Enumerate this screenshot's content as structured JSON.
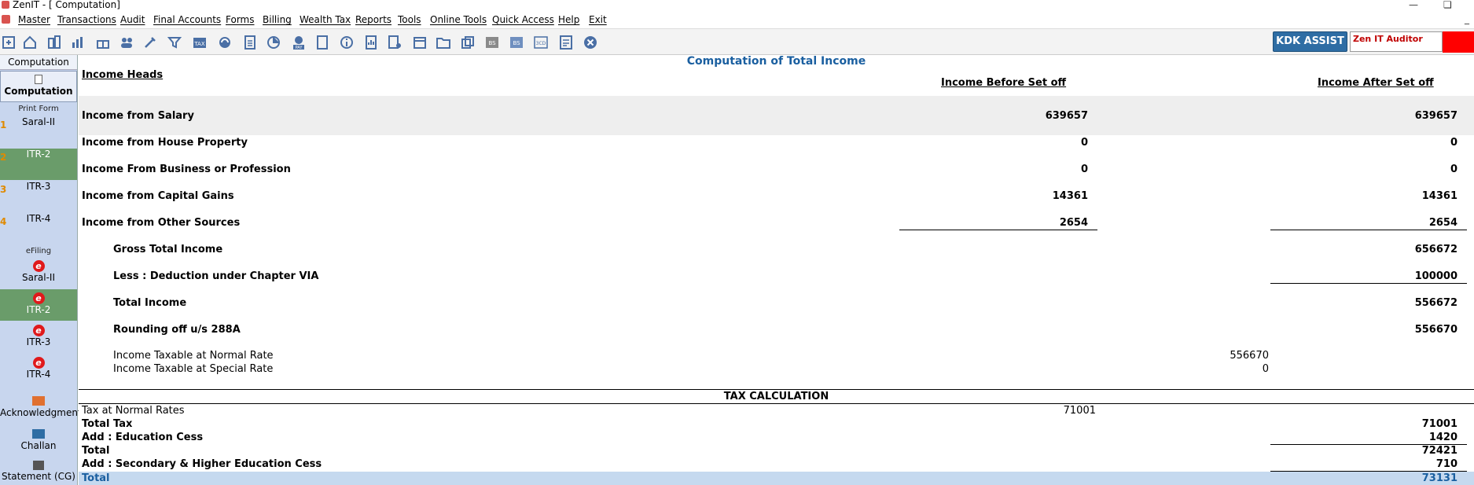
{
  "window": {
    "title": "ZenIT - [ Computation]"
  },
  "menu": [
    "Master",
    "Transactions",
    "Audit",
    "Final Accounts",
    "Forms",
    "Billing",
    "Wealth Tax",
    "Reports",
    "Tools",
    "Online Tools",
    "Quick Access",
    "Help",
    "Exit"
  ],
  "toolbar": {
    "icons": [
      "import-icon",
      "home-icon",
      "buildings-icon",
      "bar-chart-icon",
      "gift-icon",
      "users-icon",
      "tools-icon",
      "filter-icon",
      "tax-icon",
      "globe-icon",
      "calculator-icon",
      "pie-chart-icon",
      "pay-icon",
      "book-icon",
      "info-icon",
      "report-icon",
      "user-report-icon",
      "calendar-icon",
      "folder-add-icon",
      "copy-icon",
      "bs-icon",
      "bs-sch-icon",
      "3cd-icon",
      "form-icon",
      "close-circle-icon"
    ],
    "kdk_label": "KDK ASSIST",
    "zen_label": "Zen IT Auditor"
  },
  "sidebar": {
    "header": "Computation",
    "computation": "Computation",
    "print_form_label": "Print Form",
    "print_forms": [
      {
        "num": "1",
        "label": "Saral-II"
      },
      {
        "num": "2",
        "label": "ITR-2"
      },
      {
        "num": "3",
        "label": "ITR-3"
      },
      {
        "num": "4",
        "label": "ITR-4"
      }
    ],
    "efiling_label": "eFiling",
    "efiling": [
      "Saral-II",
      "ITR-2",
      "ITR-3",
      "ITR-4"
    ],
    "acknowledgment": "Acknowledgment",
    "challan": "Challan",
    "statement": "Statement (CG)"
  },
  "main": {
    "title": "Computation of Total Income",
    "income_heads_label": "Income Heads",
    "col_before": "Income Before Set off",
    "col_after": "Income After Set off",
    "heads": [
      {
        "label": "Income from Salary",
        "before": "639657",
        "after": "639657"
      },
      {
        "label": "Income from House Property",
        "before": "0",
        "after": "0"
      },
      {
        "label": "Income From Business or Profession",
        "before": "0",
        "after": "0"
      },
      {
        "label": "Income from Capital Gains",
        "before": "14361",
        "after": "14361"
      },
      {
        "label": "Income from Other Sources",
        "before": "2654",
        "after": "2654"
      }
    ],
    "gross_total": {
      "label": "Gross Total Income",
      "value": "656672"
    },
    "deduction": {
      "label": "Less : Deduction under Chapter VIA",
      "value": "100000"
    },
    "total_income": {
      "label": "Total Income",
      "value": "556672"
    },
    "rounding": {
      "label": "Rounding off u/s 288A",
      "value": "556670"
    },
    "taxable_normal": {
      "label": "Income Taxable at Normal Rate",
      "value": "556670"
    },
    "taxable_special": {
      "label": "Income Taxable at Special Rate",
      "value": "0"
    },
    "tax_calc_title": "TAX CALCULATION",
    "tax_normal": {
      "label": "Tax at Normal Rates",
      "value": "71001"
    },
    "total_tax": {
      "label": "Total Tax",
      "value": "71001"
    },
    "edu_cess": {
      "label": "Add : Education Cess",
      "value": "1420"
    },
    "total1": {
      "label": "Total",
      "value": "72421"
    },
    "sh_cess": {
      "label": "Add : Secondary & Higher Education Cess",
      "value": "710"
    },
    "total2": {
      "label": "Total",
      "value": "73131"
    }
  }
}
